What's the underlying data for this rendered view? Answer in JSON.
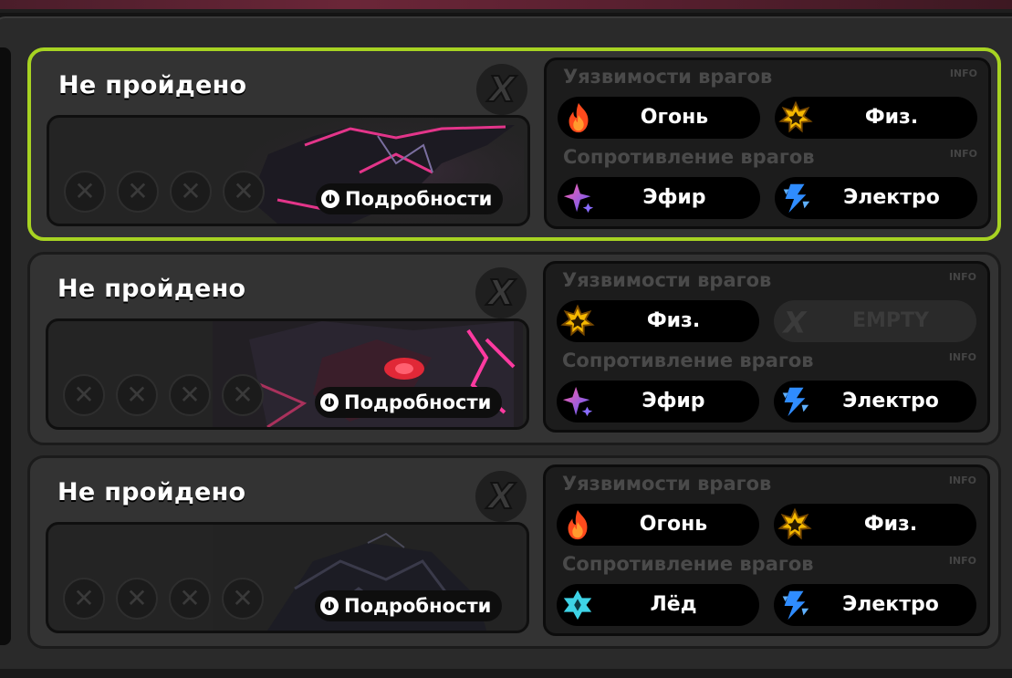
{
  "stages": [
    {
      "status": "Не пройдено",
      "details": "Подробности",
      "active": true,
      "weak_label": "Уязвимости врагов",
      "weak_info": "INFO",
      "weak": [
        {
          "icon": "fire-icon",
          "name": "Огонь"
        },
        {
          "icon": "physical-icon",
          "name": "Физ."
        }
      ],
      "res_label": "Сопротивление врагов",
      "res_info": "INFO",
      "res": [
        {
          "icon": "ether-icon",
          "name": "Эфир"
        },
        {
          "icon": "electric-icon",
          "name": "Электро"
        }
      ]
    },
    {
      "status": "Не пройдено",
      "details": "Подробности",
      "active": false,
      "weak_label": "Уязвимости врагов",
      "weak_info": "INFO",
      "weak": [
        {
          "icon": "physical-icon",
          "name": "Физ."
        },
        {
          "icon": "empty-icon",
          "name": "EMPTY"
        }
      ],
      "res_label": "Сопротивление врагов",
      "res_info": "INFO",
      "res": [
        {
          "icon": "ether-icon",
          "name": "Эфир"
        },
        {
          "icon": "electric-icon",
          "name": "Электро"
        }
      ]
    },
    {
      "status": "Не пройдено",
      "details": "Подробности",
      "active": false,
      "weak_label": "Уязвимости врагов",
      "weak_info": "INFO",
      "weak": [
        {
          "icon": "fire-icon",
          "name": "Огонь"
        },
        {
          "icon": "physical-icon",
          "name": "Физ."
        }
      ],
      "res_label": "Сопротивление врагов",
      "res_info": "INFO",
      "res": [
        {
          "icon": "ice-icon",
          "name": "Лёд"
        },
        {
          "icon": "electric-icon",
          "name": "Электро"
        }
      ]
    }
  ],
  "colors": {
    "active_border": "#a7d322",
    "fire": "#ff5a1f",
    "physical": "#f5b800",
    "ether": "#b04cff",
    "electric": "#2f8cff",
    "ice": "#3ed3e6"
  }
}
